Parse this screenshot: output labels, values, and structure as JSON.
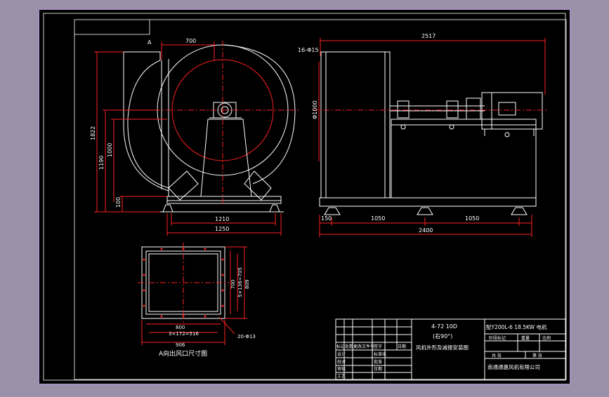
{
  "colors": {
    "background": "#000000",
    "outer_frame": "#a892c0",
    "line": "#ffffff",
    "dimension": "#ff2020",
    "hatch": "#00c8ff"
  },
  "front_view": {
    "view_label": "A",
    "dim_inlet": "700",
    "dim_total_height": "1822",
    "dim_outlet_height": "1190",
    "dim_shaft_height": "1000",
    "dim_base": "100",
    "dim_foot_span": "1210",
    "dim_base_width": "1250"
  },
  "side_view": {
    "dim_total_length": "2517",
    "dim_holes": "16-Φ15",
    "dim_casing_height": "Φ1000",
    "dim_end": "150",
    "dim_span_1": "1050",
    "dim_span_2": "1050",
    "dim_base_length": "2400"
  },
  "outlet_detail": {
    "dim_inner_width": "800",
    "dim_holes_x": "3×172=516",
    "dim_outer_width": "906",
    "dim_inner_height": "700",
    "dim_holes_y": "5×136=705",
    "dim_outer_height": "809",
    "dim_bolt_holes": "20-Φ13",
    "caption": "A向出风口尺寸图"
  },
  "title_block": {
    "model": "4-72 10D",
    "rotation": "(右90°)",
    "drawing_name": "风机外形及减振安装图",
    "motor": "配Y200L-6 18.5KW 电机",
    "stage_label": "阶段标记",
    "weight_label": "重量",
    "scale_label": "比例",
    "sheets_total": "共  张",
    "sheet_no": "第  张",
    "company": "南通通惠风机有限公司",
    "rev_headers": [
      "标记",
      "处数",
      "更改文件号",
      "签字",
      "日期"
    ],
    "sign_rows": [
      "设计",
      "校对",
      "审核",
      "工艺"
    ],
    "sign_right": [
      "标准化",
      "批准",
      "日期"
    ]
  }
}
